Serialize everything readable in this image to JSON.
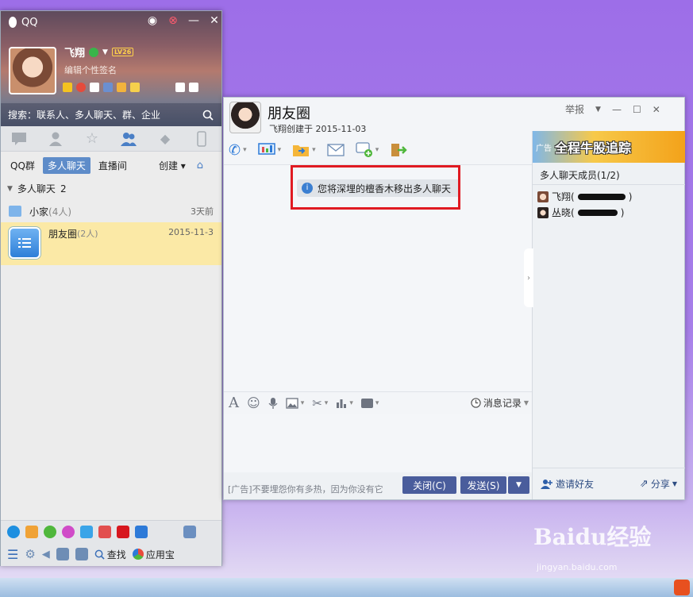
{
  "main": {
    "app_title": "QQ",
    "nickname": "飞翔",
    "level": "LV26",
    "signature": "编辑个性签名",
    "search_placeholder": "搜索：联系人、多人聊天、群、企业",
    "subtabs": [
      "QQ群",
      "多人聊天",
      "直播间"
    ],
    "create_label": "创建",
    "group_header": "多人聊天",
    "group_count": "2",
    "list": [
      {
        "name": "小家",
        "count": "(4人)",
        "time": "3天前"
      },
      {
        "name": "朋友圈",
        "count": "(2人)",
        "time": "2015-11-3"
      }
    ],
    "find_label": "查找",
    "appstore_label": "应用宝"
  },
  "chat": {
    "title": "朋友圈",
    "subtitle": "飞翔创建于 2015-11-03",
    "report_label": "举报",
    "notice": "您将深埋的檀香木移出多人聊天",
    "history_label": "消息记录",
    "ad_text": "[广告]不要埋怨你有多热，因为你没有它",
    "close_label": "关闭(C)",
    "send_label": "发送(S)",
    "side": {
      "ad_label": "广告",
      "ad_banner": "全程牛股追踪",
      "members_header": "多人聊天成员(1/2)",
      "members": [
        {
          "name": "飞翔(",
          "suffix": ")"
        },
        {
          "name": "丛晓(",
          "suffix": ")"
        }
      ],
      "invite_label": "邀请好友",
      "share_label": "分享"
    }
  },
  "watermark": {
    "logo": "Baidu经验",
    "url": "jingyan.baidu.com"
  },
  "colors": {
    "accent": "#4a5d9c",
    "highlight_border": "#e01a22",
    "selected_row": "#fbe9a6"
  }
}
